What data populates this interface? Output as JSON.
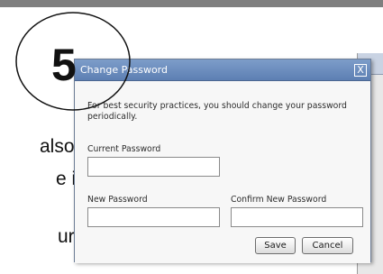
{
  "background_text": {
    "line1": "also",
    "line2": "e it in",
    "line3": "ur"
  },
  "callout": {
    "step_number": "5"
  },
  "dialog": {
    "title": "Change Password",
    "close_glyph": "X",
    "info_text": "For best security practices, you should change your password periodically.",
    "current_password_label": "Current Password",
    "current_password_value": "",
    "new_password_label": "New Password",
    "new_password_value": "",
    "confirm_password_label": "Confirm New Password",
    "confirm_password_value": "",
    "save_label": "Save",
    "cancel_label": "Cancel"
  },
  "colors": {
    "titlebar": "#6a8bbe",
    "dialog_bg": "#f7f7f7",
    "top_strip": "#7f7f7f"
  }
}
